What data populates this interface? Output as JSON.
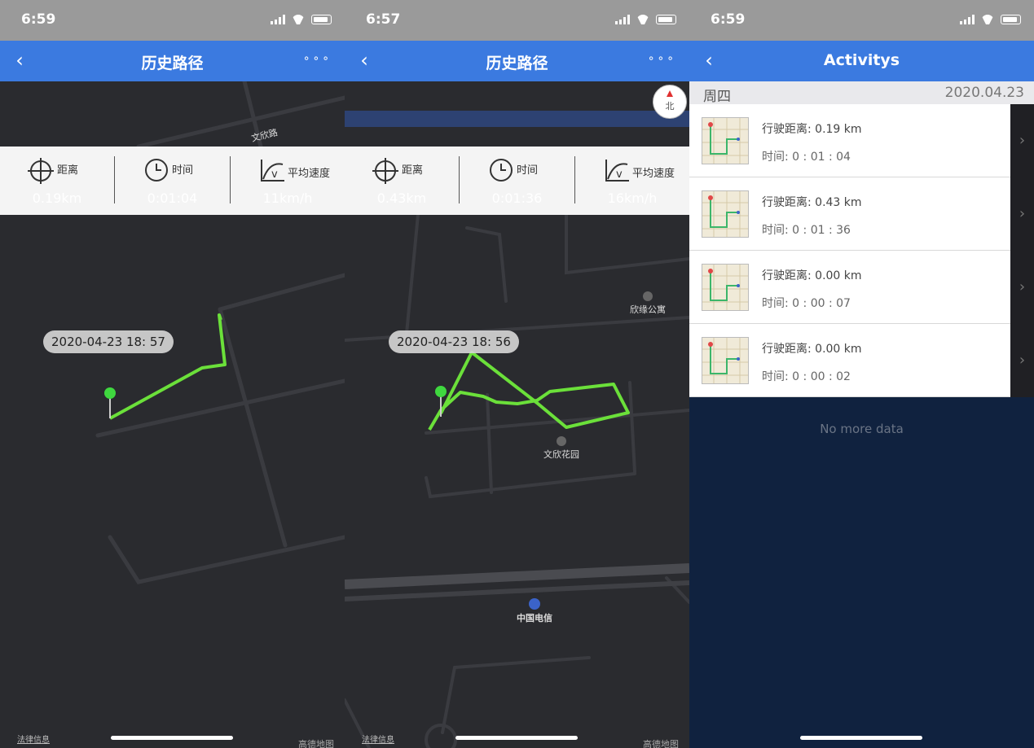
{
  "screens": [
    {
      "status_time": "6:59",
      "nav": {
        "title": "历史路径",
        "back": "‹",
        "more": "∘∘∘"
      },
      "stats": {
        "distance_label": "距离",
        "distance_value": "0.19km",
        "time_label": "时间",
        "time_value": "0:01:04",
        "speed_label": "平均速度",
        "speed_value": "11km/h"
      },
      "bubble": "2020-04-23  18: 57",
      "map_labels": {
        "road": "文欣路"
      },
      "legal": "法律信息",
      "attribution": "高德地图"
    },
    {
      "status_time": "6:57",
      "nav": {
        "title": "历史路径",
        "back": "‹",
        "more": "∘∘∘"
      },
      "compass": "北",
      "stats": {
        "distance_label": "距离",
        "distance_value": "0.43km",
        "time_label": "时间",
        "time_value": "0:01:36",
        "speed_label": "平均速度",
        "speed_value": "16km/h"
      },
      "bubble": "2020-04-23  18: 56",
      "map_labels": {
        "poi1": "欣缘公寓",
        "poi2": "文欣花园",
        "poi3": "中国电信"
      },
      "legal": "法律信息",
      "attribution": "高德地图"
    },
    {
      "status_time": "6:59",
      "nav": {
        "title": "Activitys",
        "back": "‹"
      },
      "day": "周四",
      "date": "2020.04.23",
      "items": [
        {
          "distance": "行驶距离: 0.19 km",
          "duration": "时间: 0 : 01 : 04"
        },
        {
          "distance": "行驶距离: 0.43 km",
          "duration": "时间: 0 : 01 : 36"
        },
        {
          "distance": "行驶距离: 0.00 km",
          "duration": "时间: 0 : 00 : 07"
        },
        {
          "distance": "行驶距离: 0.00 km",
          "duration": "时间: 0 : 00 : 02"
        }
      ],
      "no_more": "No more data"
    }
  ],
  "colors": {
    "nav": "#3b7ae0",
    "map": "#2a2b2f",
    "track": "#6be03a",
    "list_bg": "#10223f"
  }
}
